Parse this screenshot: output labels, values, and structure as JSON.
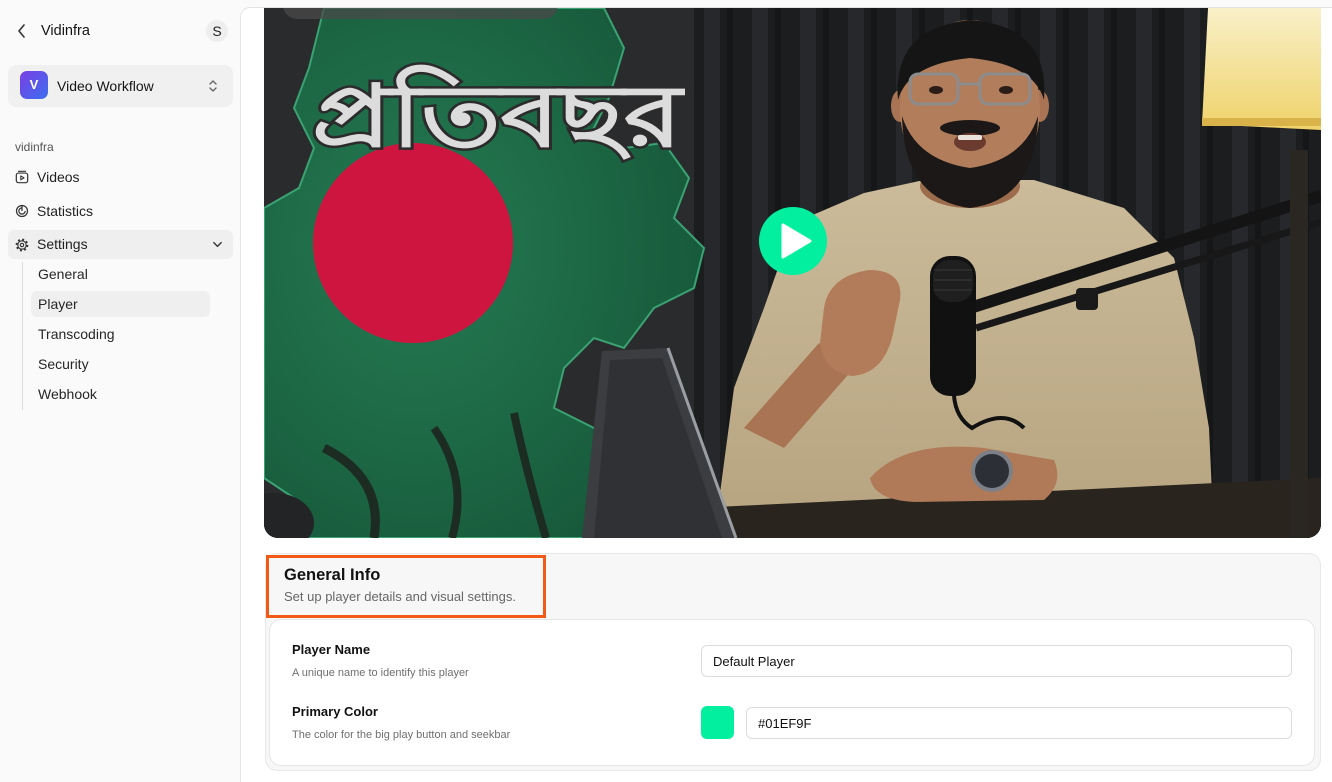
{
  "sidebar": {
    "back_label": "Vidinfra",
    "avatar_initial": "S",
    "workspace": {
      "logo_letter": "V",
      "name": "Video Workflow"
    },
    "section_label": "vidinfra",
    "nav": [
      {
        "label": "Videos",
        "icon": "video-library-icon"
      },
      {
        "label": "Statistics",
        "icon": "statistics-icon"
      },
      {
        "label": "Settings",
        "icon": "gear-icon",
        "expanded": true
      }
    ],
    "settings_items": [
      {
        "label": "General"
      },
      {
        "label": "Player",
        "active": true
      },
      {
        "label": "Transcoding"
      },
      {
        "label": "Security"
      },
      {
        "label": "Webhook"
      }
    ]
  },
  "video_preview": {
    "thumbnail_text": "প্রতিবছর",
    "play_icon": "play-icon"
  },
  "general_info": {
    "title": "General Info",
    "subtitle": "Set up player details and visual settings.",
    "fields": {
      "player_name": {
        "label": "Player Name",
        "help": "A unique name to identify this player",
        "value": "Default Player"
      },
      "primary_color": {
        "label": "Primary Color",
        "help": "The color for the big play button and seekbar",
        "value": "#01EF9F"
      }
    }
  },
  "colors": {
    "accent": "#01EF9F",
    "highlight_outline": "#F05A16",
    "brand_logo": [
      "#7B3FE4",
      "#3B6EF0"
    ]
  }
}
